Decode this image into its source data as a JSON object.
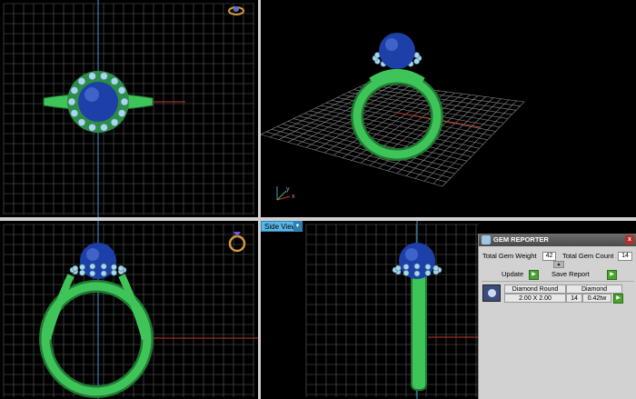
{
  "views": {
    "side_view_label": "Side View"
  },
  "gem_reporter": {
    "title": "GEM REPORTER",
    "close_glyph": "x",
    "total_gem_weight_label": "Total Gem Weight",
    "total_gem_weight_value": "42",
    "total_gem_count_label": "Total Gem Count",
    "total_gem_count_value": "14",
    "update_label": "Update",
    "save_report_label": "Save Report",
    "gem": {
      "name": "Diamond Round",
      "size": "2.00 X 2.00",
      "type": "Diamond",
      "count": "14",
      "weight": "0.42tw"
    }
  },
  "colors": {
    "ring_green": "#3fc45a",
    "center_stone": "#1d3fa8",
    "halo_diamond": "#a9d6e8",
    "grid": "#6a6a6a",
    "axis_red": "#c0392b",
    "axis_blue": "#3e9bd6",
    "panel_bg": "#d2d2d2"
  },
  "icons": [
    "ring-top-icon",
    "ring-front-icon",
    "axis-gizmo-icon",
    "gem-reporter-logo-icon",
    "close-icon",
    "arrow-right-icon",
    "gem-thumbnail-icon"
  ]
}
